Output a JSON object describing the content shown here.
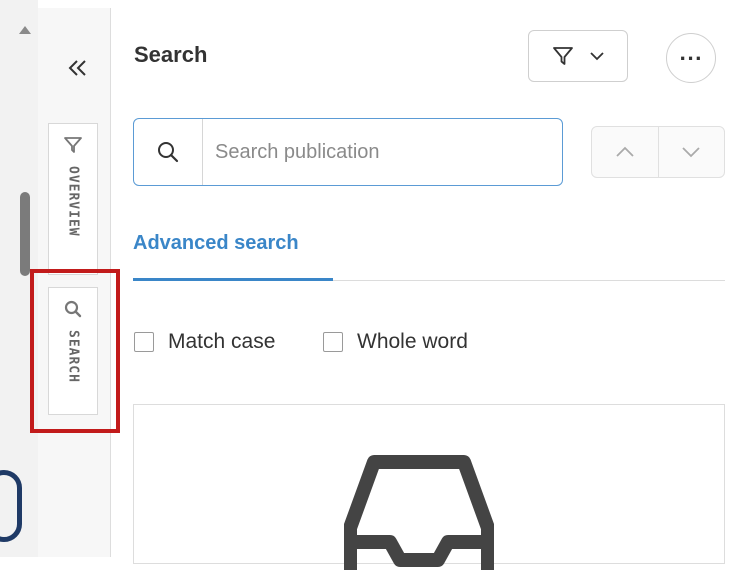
{
  "panel": {
    "title": "Search"
  },
  "rail": {
    "collapse_icon": "double-chevron-left-icon",
    "tabs": [
      {
        "label": "OVERVIEW",
        "icon": "filter-icon"
      },
      {
        "label": "SEARCH",
        "icon": "search-icon"
      }
    ]
  },
  "toolbar": {
    "filter_icon": "filter-icon",
    "dropdown_icon": "chevron-down-icon",
    "more_label": "..."
  },
  "search": {
    "placeholder": "Search publication",
    "value": ""
  },
  "navigation": {
    "prev_icon": "chevron-up-icon",
    "next_icon": "chevron-down-icon"
  },
  "tabs": {
    "advanced_search": "Advanced search"
  },
  "options": {
    "match_case": "Match case",
    "whole_word": "Whole word"
  },
  "results": {
    "empty_icon": "inbox-icon"
  },
  "colors": {
    "accent": "#3a86c8",
    "highlight": "#c21b1b"
  }
}
